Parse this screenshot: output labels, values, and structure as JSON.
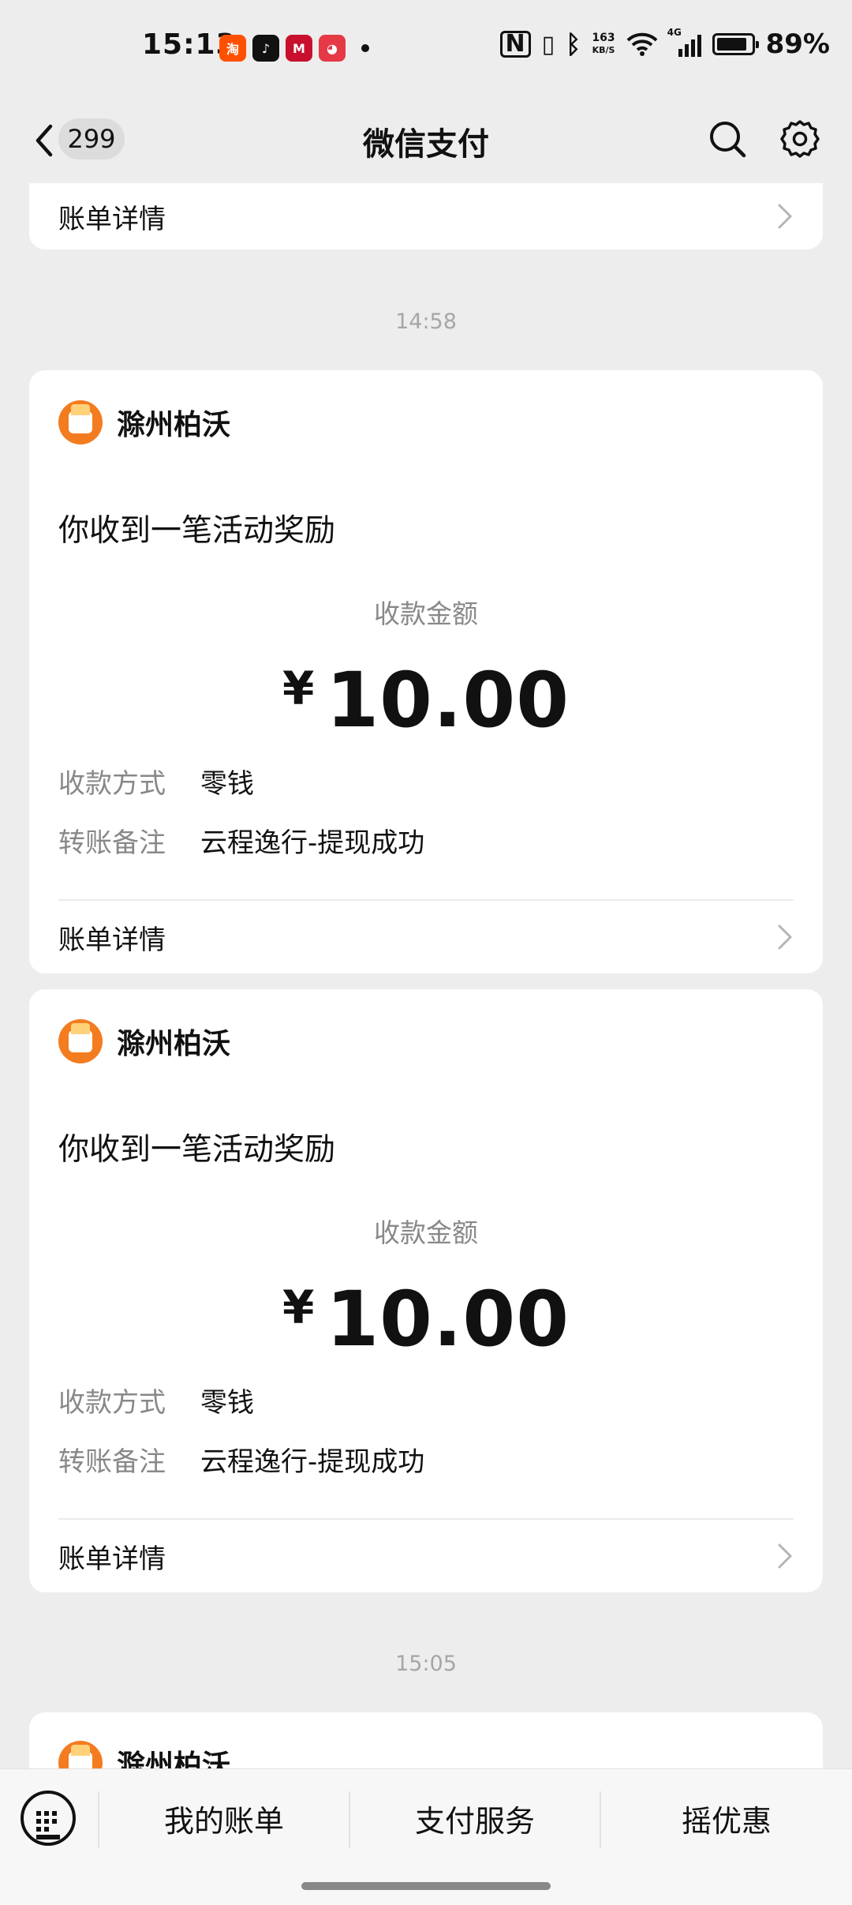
{
  "status_bar": {
    "time": "15:13",
    "net_speed_value": "163",
    "net_speed_unit": "KB/S",
    "signal_label": "4G",
    "battery_percent": "89%",
    "battery_level": 0.89,
    "app_icons": [
      "taobao-icon",
      "douyin-icon",
      "bank-icon",
      "game-icon"
    ]
  },
  "header": {
    "unread_count": "299",
    "title": "微信支付"
  },
  "top_card": {
    "detail_label": "账单详情"
  },
  "timestamps": [
    "14:58",
    "15:05"
  ],
  "cards": [
    {
      "merchant": "滁州柏沃",
      "headline": "你收到一笔活动奖励",
      "amount_label": "收款金额",
      "currency": "¥",
      "amount": "10.00",
      "method_key": "收款方式",
      "method_value": "零钱",
      "note_key": "转账备注",
      "note_value": "云程逸行-提现成功",
      "detail_label": "账单详情"
    },
    {
      "merchant": "滁州柏沃",
      "headline": "你收到一笔活动奖励",
      "amount_label": "收款金额",
      "currency": "¥",
      "amount": "10.00",
      "method_key": "收款方式",
      "method_value": "零钱",
      "note_key": "转账备注",
      "note_value": "云程逸行-提现成功",
      "detail_label": "账单详情"
    },
    {
      "merchant": "滁州柏沃"
    }
  ],
  "bottom_menu": [
    "我的账单",
    "支付服务",
    "摇优惠"
  ],
  "colors": {
    "page_bg": "#ededed",
    "card_bg": "#ffffff",
    "merchant_avatar": "#f47c20",
    "muted_text": "#888888"
  }
}
